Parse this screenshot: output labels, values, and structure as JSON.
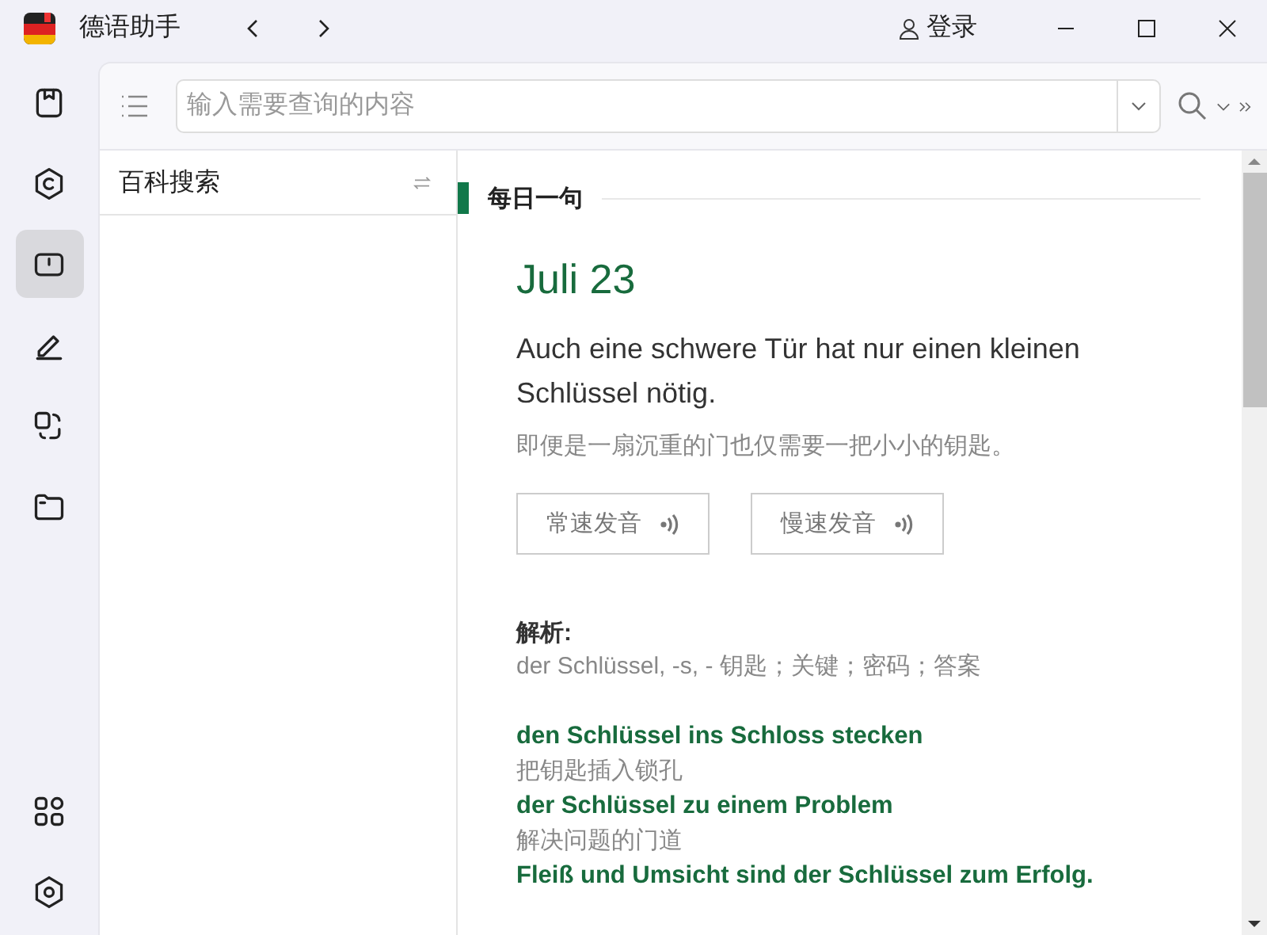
{
  "window": {
    "title": "德语助手",
    "login": "登录"
  },
  "rail": {
    "items": [
      {
        "selected": false
      },
      {
        "selected": false
      },
      {
        "selected": true
      },
      {
        "selected": false
      },
      {
        "selected": false
      },
      {
        "selected": false
      }
    ],
    "bottom": [
      {
        "selected": false
      },
      {
        "selected": false
      }
    ]
  },
  "search": {
    "placeholder": "输入需要查询的内容"
  },
  "side_panel": {
    "title": "百科搜索"
  },
  "daily": {
    "heading": "每日一句",
    "date": "Juli 23",
    "sentence": "Auch eine schwere Tür hat nur einen kleinen Schlüssel nötig.",
    "translation": "即便是一扇沉重的门也仅需要一把小小的钥匙。",
    "buttons": [
      "常速发音",
      "慢速发音"
    ],
    "analysis_label": "解析:",
    "definition": "der Schlüssel, -s, - 钥匙；关键；密码；答案",
    "phrases": [
      {
        "de": "den Schlüssel ins Schloss stecken",
        "zh": "把钥匙插入锁孔"
      },
      {
        "de": "der Schlüssel zu einem Problem",
        "zh": "解决问题的门道"
      },
      {
        "de": "Fleiß und Umsicht sind der Schlüssel zum Erfolg."
      }
    ]
  }
}
